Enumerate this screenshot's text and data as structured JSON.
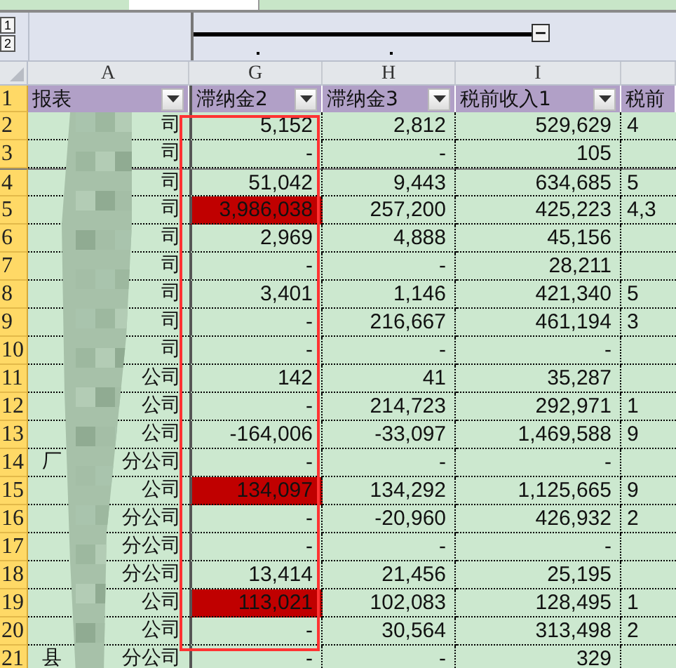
{
  "outline": {
    "levels": [
      "1",
      "2"
    ],
    "collapse_button": "−"
  },
  "columns": [
    "A",
    "G",
    "H",
    "I"
  ],
  "header_row": {
    "number": "1",
    "cells": [
      {
        "text": "报表",
        "filter": true
      },
      {
        "text": "滞纳金2",
        "filter": true
      },
      {
        "text": "滞纳金3",
        "filter": true
      },
      {
        "text": "税前收入1",
        "filter": true
      },
      {
        "text": "税前",
        "filter": false
      }
    ]
  },
  "rows": [
    {
      "number": "2",
      "a": "司",
      "g": "5,152",
      "h": "2,812",
      "i": "529,629",
      "j": "4",
      "highlight": false
    },
    {
      "number": "3",
      "a": "司",
      "g": "-",
      "h": "-",
      "i": "105",
      "j": "",
      "highlight": false
    },
    {
      "number": "4",
      "a": "司",
      "g": "51,042",
      "h": "9,443",
      "i": "634,685",
      "j": "5",
      "highlight": false
    },
    {
      "number": "5",
      "a": "司",
      "g": "3,986,038",
      "h": "257,200",
      "i": "425,223",
      "j": "4,3",
      "highlight": true
    },
    {
      "number": "6",
      "a": "司",
      "g": "2,969",
      "h": "4,888",
      "i": "45,156",
      "j": "",
      "highlight": false
    },
    {
      "number": "7",
      "a": "司",
      "g": "-",
      "h": "-",
      "i": "28,211",
      "j": "",
      "highlight": false
    },
    {
      "number": "8",
      "a": "司",
      "g": "3,401",
      "h": "1,146",
      "i": "421,340",
      "j": "5",
      "highlight": false
    },
    {
      "number": "9",
      "a": "司",
      "g": "-",
      "h": "216,667",
      "i": "461,194",
      "j": "3",
      "highlight": false
    },
    {
      "number": "10",
      "a": "司",
      "g": "-",
      "h": "-",
      "i": "-",
      "j": "",
      "highlight": false
    },
    {
      "number": "11",
      "a": "公司",
      "g": "142",
      "h": "41",
      "i": "35,287",
      "j": "",
      "highlight": false
    },
    {
      "number": "12",
      "a": "公司",
      "g": "-",
      "h": "214,723",
      "i": "292,971",
      "j": "1",
      "highlight": false
    },
    {
      "number": "13",
      "a": "公司",
      "g": "-164,006",
      "h": "-33,097",
      "i": "1,469,588",
      "j": "9",
      "highlight": false
    },
    {
      "number": "14",
      "a": "厂",
      "a2": "分公司",
      "g": "-",
      "h": "-",
      "i": "-",
      "j": "",
      "highlight": false
    },
    {
      "number": "15",
      "a": "公司",
      "g": "134,097",
      "h": "134,292",
      "i": "1,125,665",
      "j": "9",
      "highlight": true
    },
    {
      "number": "16",
      "a": "分公司",
      "g": "-",
      "h": "-20,960",
      "i": "426,932",
      "j": "2",
      "highlight": false
    },
    {
      "number": "17",
      "a": "分公司",
      "g": "-",
      "h": "-",
      "i": "-",
      "j": "",
      "highlight": false
    },
    {
      "number": "18",
      "a": "分公司",
      "g": "13,414",
      "h": "21,456",
      "i": "25,195",
      "j": "",
      "highlight": false
    },
    {
      "number": "19",
      "a": "公司",
      "g": "113,021",
      "h": "102,083",
      "i": "128,495",
      "j": "1",
      "highlight": true
    },
    {
      "number": "20",
      "a": "公司",
      "g": "-",
      "h": "30,564",
      "i": "313,498",
      "j": "2",
      "highlight": false
    },
    {
      "number": "21",
      "a": "县",
      "a2": "分公司",
      "g": "-",
      "h": "-",
      "i": "329",
      "j": "",
      "highlight": false
    }
  ]
}
